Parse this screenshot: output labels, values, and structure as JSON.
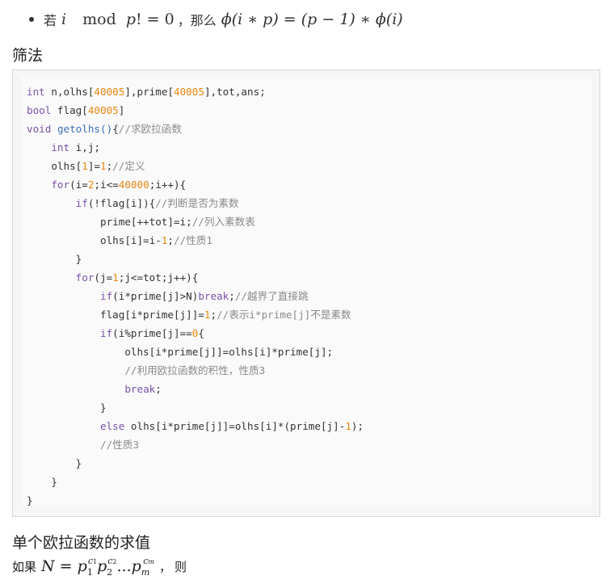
{
  "bullet": {
    "prefix": "若",
    "i": "i",
    "mod": "mod",
    "p_fact": "p",
    "bang_eq": "! = 0",
    "comma": "，",
    "then": "那么",
    "formula": "ϕ(i ∗ p) = (p − 1) ∗ ϕ(i)"
  },
  "section_sieve": "筛法",
  "code_lines": [
    [
      [
        "kw",
        "int"
      ],
      [
        "t",
        " n,olhs["
      ],
      [
        "num",
        "40005"
      ],
      [
        "t",
        "],prime["
      ],
      [
        "num",
        "40005"
      ],
      [
        "t",
        "],tot,ans;"
      ]
    ],
    [
      [
        "kw",
        "bool"
      ],
      [
        "t",
        " flag["
      ],
      [
        "num",
        "40005"
      ],
      [
        "t",
        "]"
      ]
    ],
    [
      [
        "kw",
        "void"
      ],
      [
        "t",
        " "
      ],
      [
        "fn",
        "getolhs"
      ],
      [
        "fn",
        "()"
      ],
      [
        "t",
        "{"
      ],
      [
        "cm",
        "//求欧拉函数"
      ]
    ],
    [
      [
        "t",
        "    "
      ],
      [
        "kw",
        "int"
      ],
      [
        "t",
        " i,j;"
      ]
    ],
    [
      [
        "t",
        "    olhs["
      ],
      [
        "num",
        "1"
      ],
      [
        "t",
        "]="
      ],
      [
        "num",
        "1"
      ],
      [
        "t",
        ";"
      ],
      [
        "cm",
        "//定义"
      ]
    ],
    [
      [
        "t",
        "    "
      ],
      [
        "kw",
        "for"
      ],
      [
        "t",
        "(i="
      ],
      [
        "num",
        "2"
      ],
      [
        "t",
        ";i<="
      ],
      [
        "num",
        "40000"
      ],
      [
        "t",
        ";i++){"
      ]
    ],
    [
      [
        "t",
        "        "
      ],
      [
        "kw",
        "if"
      ],
      [
        "t",
        "(!flag[i]){"
      ],
      [
        "cm",
        "//判断是否为素数"
      ]
    ],
    [
      [
        "t",
        "            prime[++tot]=i;"
      ],
      [
        "cm",
        "//列入素数表"
      ]
    ],
    [
      [
        "t",
        "            olhs[i]=i-"
      ],
      [
        "num",
        "1"
      ],
      [
        "t",
        ";"
      ],
      [
        "cm",
        "//性质1"
      ]
    ],
    [
      [
        "t",
        "        }"
      ]
    ],
    [
      [
        "t",
        "        "
      ],
      [
        "kw",
        "for"
      ],
      [
        "t",
        "(j="
      ],
      [
        "num",
        "1"
      ],
      [
        "t",
        ";j<=tot;j++){"
      ]
    ],
    [
      [
        "t",
        "            "
      ],
      [
        "kw",
        "if"
      ],
      [
        "t",
        "(i*prime[j]>N)"
      ],
      [
        "kw",
        "break"
      ],
      [
        "t",
        ";"
      ],
      [
        "cm",
        "//越界了直接跳"
      ]
    ],
    [
      [
        "t",
        "            flag[i*prime[j]]="
      ],
      [
        "num",
        "1"
      ],
      [
        "t",
        ";"
      ],
      [
        "cm",
        "//表示i*prime[j]不是素数"
      ]
    ],
    [
      [
        "t",
        "            "
      ],
      [
        "kw",
        "if"
      ],
      [
        "t",
        "(i%prime[j]=="
      ],
      [
        "num",
        "0"
      ],
      [
        "t",
        "{"
      ]
    ],
    [
      [
        "t",
        "                olhs[i*prime[j]]=olhs[i]*prime[j];"
      ]
    ],
    [
      [
        "t",
        "                "
      ],
      [
        "cm",
        "//利用欧拉函数的积性，性质3"
      ]
    ],
    [
      [
        "t",
        "                "
      ],
      [
        "kw",
        "break"
      ],
      [
        "t",
        ";"
      ]
    ],
    [
      [
        "t",
        "            }"
      ]
    ],
    [
      [
        "t",
        "            "
      ],
      [
        "kw",
        "else"
      ],
      [
        "t",
        " olhs[i*prime[j]]=olhs[i]*(prime[j]-"
      ],
      [
        "num",
        "1"
      ],
      [
        "t",
        ");"
      ]
    ],
    [
      [
        "t",
        "            "
      ],
      [
        "cm",
        "//性质3"
      ]
    ],
    [
      [
        "t",
        "        }"
      ]
    ],
    [
      [
        "t",
        "    }"
      ]
    ],
    [
      [
        "t",
        "}"
      ]
    ]
  ],
  "section_single": "单个欧拉函数的求值",
  "bottom": {
    "prefix": "如果",
    "N": "N",
    "eq": " = ",
    "p": "p",
    "c1": "c",
    "c1sub": "1",
    "s1": "1",
    "c2sub": "2",
    "s2": "2",
    "dots": "...",
    "m": "m",
    "comma": "，",
    "then": "则"
  },
  "colors": {
    "keyword": "#7a52a8",
    "function": "#3d6fb5",
    "number": "#e8860f",
    "comment": "#8a8a8a"
  }
}
